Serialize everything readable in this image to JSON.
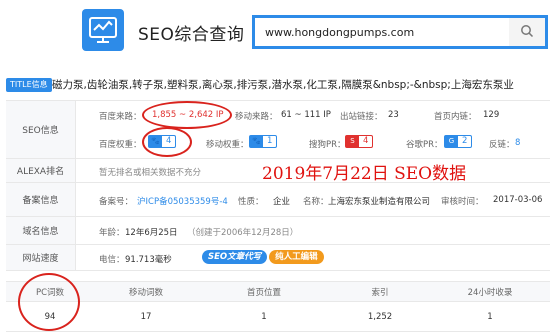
{
  "app": {
    "title": "SEO综合查询",
    "search_value": "www.hongdongpumps.com"
  },
  "site_title": {
    "tag": "TITLE信息",
    "text": "磁力泵,齿轮油泵,转子泵,塑料泵,离心泵,排污泵,潜水泵,化工泵,隔膜泵&nbsp;-&nbsp;上海宏东泵业"
  },
  "seo": {
    "label": "SEO信息",
    "baidu_traffic_label": "百度来路：",
    "baidu_traffic_value": "1,855 ~ 2,642 IP",
    "mobile_traffic_label": "移动来路：",
    "mobile_traffic_value": "61 ~ 111 IP",
    "outlinks_label": "出站链接：",
    "outlinks_value": "23",
    "home_inlinks_label": "首页内链：",
    "home_inlinks_value": "129",
    "baidu_weight_label": "百度权重：",
    "baidu_weight_value": "4",
    "mobile_weight_label": "移动权重：",
    "mobile_weight_value": "1",
    "sogou_pr_label": "搜狗PR：",
    "sogou_pr_value": "4",
    "google_pr_label": "谷歌PR：",
    "google_pr_value": "2",
    "backlinks_label": "反链：",
    "backlinks_value": "8"
  },
  "annotation": "2019年7月22日  SEO数据",
  "alexa": {
    "label": "ALEXA排名",
    "value": "暂无排名或相关数据不充分"
  },
  "beian": {
    "label": "备案信息",
    "number_label": "备案号：",
    "number_value": "沪ICP备05035359号-4",
    "nature_label": "性质：",
    "nature_value": "企业",
    "name_label": "名称：",
    "name_value": "上海宏东泵业制造有限公司",
    "date_label": "审核时间：",
    "date_value": "2017-03-06"
  },
  "domain": {
    "label": "域名信息",
    "age_label": "年龄：",
    "age_value": "12年6月25日",
    "created": "（创建于2006年12月28日）"
  },
  "speed": {
    "label": "网站速度",
    "time_label": "电信：",
    "time_value": "91.713毫秒",
    "badge1": "SEO文章代写",
    "badge2": "纯人工编辑"
  },
  "stats": {
    "headers": [
      "PC词数",
      "移动词数",
      "首页位置",
      "索引",
      "24小时收录"
    ],
    "values": [
      "94",
      "17",
      "1",
      "1,252",
      "1"
    ]
  },
  "colors": {
    "accent": "#2d8be8",
    "red": "#e0312f",
    "annotation": "#e0120f"
  }
}
